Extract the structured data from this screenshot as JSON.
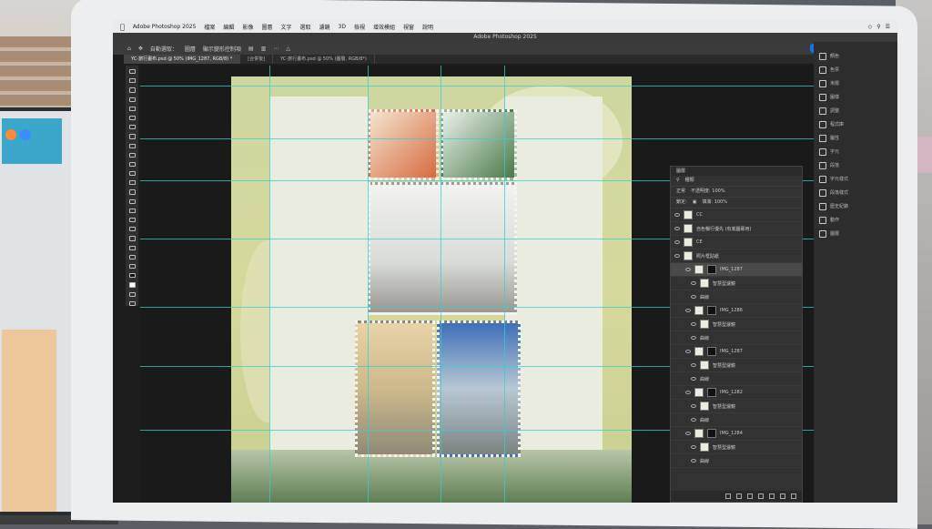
{
  "app": {
    "window_title": "Adobe Photoshop 2025",
    "menu": [
      "Adobe Photoshop 2025",
      "檔案",
      "編輯",
      "影像",
      "圖層",
      "文字",
      "選取",
      "濾鏡",
      "3D",
      "檢視",
      "增效模組",
      "視窗",
      "說明"
    ],
    "share_label": "分享"
  },
  "options": {
    "auto_select": "自動選取：",
    "target": "圖層",
    "transform": "顯示變形控制項"
  },
  "tabs": [
    {
      "label": "YC-旅行畫布.psd @ 50% (IMG_1287, RGB/8) *"
    },
    {
      "label": "[合併後]"
    },
    {
      "label": "YC-旅行畫布.psd @ 50% (圖層, RGB/8*)"
    }
  ],
  "right_panel": {
    "items": [
      "顏色",
      "色票",
      "漸層",
      "圖樣",
      "調整",
      "程式庫",
      "屬性",
      "字元",
      "段落",
      "字元樣式",
      "段落樣式",
      "歷史紀錄",
      "動作",
      "圖層"
    ]
  },
  "layers_panel": {
    "title": "圖層",
    "filter_label": "種類",
    "blend_mode": "正常",
    "opacity_label": "不透明度: 100%",
    "lock_label": "鎖定:",
    "fill_label": "填滿: 100%",
    "layers": [
      {
        "name": "CC",
        "type": "layer",
        "selected": false,
        "indent": 0
      },
      {
        "name": "自色暢行優先 (有底圖專用)",
        "type": "layer",
        "selected": false,
        "indent": 0
      },
      {
        "name": "CE",
        "type": "layer",
        "selected": false,
        "indent": 0
      },
      {
        "name": "照片框貼紙",
        "type": "group",
        "selected": false,
        "indent": 0
      },
      {
        "name": "IMG_1287",
        "type": "smart",
        "selected": true,
        "indent": 1
      },
      {
        "name": "智慧型濾鏡",
        "type": "filter",
        "selected": false,
        "indent": 2
      },
      {
        "name": "曲線",
        "type": "fx",
        "selected": false,
        "indent": 2
      },
      {
        "name": "IMG_1286",
        "type": "smart",
        "selected": false,
        "indent": 1
      },
      {
        "name": "智慧型濾鏡",
        "type": "filter",
        "selected": false,
        "indent": 2
      },
      {
        "name": "曲線",
        "type": "fx",
        "selected": false,
        "indent": 2
      },
      {
        "name": "IMG_1287",
        "type": "smart",
        "selected": false,
        "indent": 1
      },
      {
        "name": "智慧型濾鏡",
        "type": "filter",
        "selected": false,
        "indent": 2
      },
      {
        "name": "曲線",
        "type": "fx",
        "selected": false,
        "indent": 2
      },
      {
        "name": "IMG_1282",
        "type": "smart",
        "selected": false,
        "indent": 1
      },
      {
        "name": "智慧型濾鏡",
        "type": "filter",
        "selected": false,
        "indent": 2
      },
      {
        "name": "曲線",
        "type": "fx",
        "selected": false,
        "indent": 2
      },
      {
        "name": "IMG_1284",
        "type": "smart",
        "selected": false,
        "indent": 1
      },
      {
        "name": "智慧型濾鏡",
        "type": "filter",
        "selected": false,
        "indent": 2
      },
      {
        "name": "曲線",
        "type": "fx",
        "selected": false,
        "indent": 2
      }
    ]
  },
  "colors": {
    "guide": "#2fd0d0",
    "canvas_bg": "#cfd6a0",
    "accent": "#1473e6"
  }
}
